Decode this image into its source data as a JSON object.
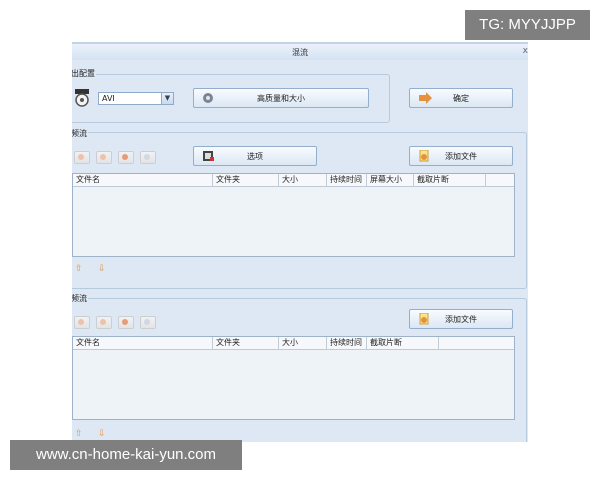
{
  "window": {
    "title": "混流",
    "close": "x"
  },
  "output": {
    "legend": "输出配置",
    "format": "AVI",
    "quality_button": "高质量和大小",
    "ok_button": "确定"
  },
  "video_stream": {
    "legend": "视频流",
    "options_button": "选项",
    "add_file_button": "添加文件",
    "columns": [
      "文件名",
      "文件夹",
      "大小",
      "持续时间",
      "屏幕大小",
      "截取片断"
    ]
  },
  "audio_stream": {
    "legend": "音频流",
    "add_file_button": "添加文件",
    "columns": [
      "文件名",
      "文件夹",
      "大小",
      "持续时间",
      "截取片断"
    ]
  },
  "watermarks": {
    "top": "TG: MYYJJPP",
    "bottom": "www.cn-home-kai-yun.com"
  },
  "colors": {
    "window_bg": "#dde8f4",
    "accent_arrow": "#e6913e"
  }
}
